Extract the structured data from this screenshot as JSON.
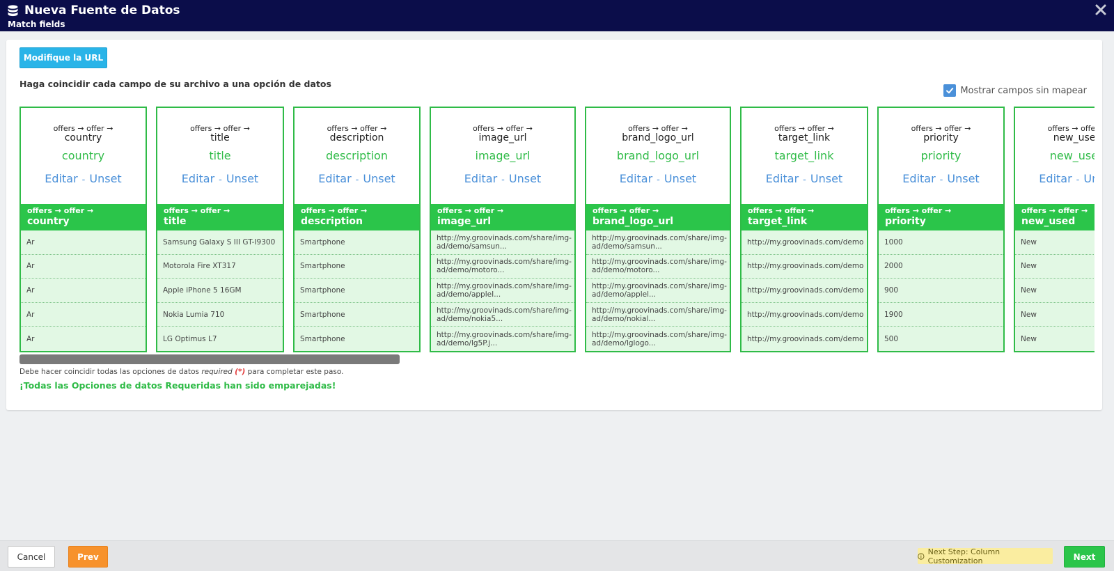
{
  "header": {
    "title": "Nueva Fuente de Datos",
    "subtitle": "Match fields"
  },
  "main": {
    "url_button": "Modifique la URL",
    "instruction": "Haga coincidir cada campo de su archivo a una opción de datos",
    "show_unmapped_label": "Mostrar campos sin mapear",
    "show_unmapped_checked": true,
    "columns": [
      {
        "path": "offers → offer →",
        "field": "country",
        "mapped": "country",
        "edit": "Editar",
        "unset": "Unset",
        "band_path": "offers → offer →",
        "band_name": "country",
        "rows": [
          "Ar",
          "Ar",
          "Ar",
          "Ar",
          "Ar"
        ]
      },
      {
        "path": "offers → offer →",
        "field": "title",
        "mapped": "title",
        "edit": "Editar",
        "unset": "Unset",
        "band_path": "offers → offer →",
        "band_name": "title",
        "rows": [
          "Samsung Galaxy S III GT-I9300",
          "Motorola Fire XT317",
          "Apple iPhone 5 16GM",
          "Nokia Lumia 710",
          "LG Optimus L7"
        ]
      },
      {
        "path": "offers → offer →",
        "field": "description",
        "mapped": "description",
        "edit": "Editar",
        "unset": "Unset",
        "band_path": "offers → offer →",
        "band_name": "description",
        "rows": [
          "Smartphone",
          "Smartphone",
          "Smartphone",
          "Smartphone",
          "Smartphone"
        ]
      },
      {
        "path": "offers → offer →",
        "field": "image_url",
        "mapped": "image_url",
        "edit": "Editar",
        "unset": "Unset",
        "band_path": "offers → offer →",
        "band_name": "image_url",
        "rows": [
          "http://my.groovinads.com/share/img-ad/demo/samsun...",
          "http://my.groovinads.com/share/img-ad/demo/motoro...",
          "http://my.groovinads.com/share/img-ad/demo/appleI...",
          "http://my.groovinads.com/share/img-ad/demo/nokia5...",
          "http://my.groovinads.com/share/img-ad/demo/lg5P.j..."
        ]
      },
      {
        "path": "offers → offer →",
        "field": "brand_logo_url",
        "mapped": "brand_logo_url",
        "edit": "Editar",
        "unset": "Unset",
        "band_path": "offers → offer →",
        "band_name": "brand_logo_url",
        "rows": [
          "http://my.groovinads.com/share/img-ad/demo/samsun...",
          "http://my.groovinads.com/share/img-ad/demo/motoro...",
          "http://my.groovinads.com/share/img-ad/demo/applel...",
          "http://my.groovinads.com/share/img-ad/demo/nokial...",
          "http://my.groovinads.com/share/img-ad/demo/lglogo..."
        ]
      },
      {
        "path": "offers → offer →",
        "field": "target_link",
        "mapped": "target_link",
        "edit": "Editar",
        "unset": "Unset",
        "band_path": "offers → offer →",
        "band_name": "target_link",
        "rows": [
          "http://my.groovinads.com/demo",
          "http://my.groovinads.com/demo",
          "http://my.groovinads.com/demo",
          "http://my.groovinads.com/demo",
          "http://my.groovinads.com/demo"
        ]
      },
      {
        "path": "offers → offer →",
        "field": "priority",
        "mapped": "priority",
        "edit": "Editar",
        "unset": "Unset",
        "band_path": "offers → offer →",
        "band_name": "priority",
        "rows": [
          "1000",
          "2000",
          "900",
          "1900",
          "500"
        ]
      },
      {
        "path": "offers → offer →",
        "field": "new_used",
        "mapped": "new_used",
        "edit": "Editar",
        "unset": "Unset",
        "band_path": "offers → offer →",
        "band_name": "new_used",
        "rows": [
          "New",
          "New",
          "New",
          "New",
          "New"
        ]
      }
    ],
    "note_prefix": "Debe hacer coincidir todas las opciones de datos",
    "note_required": "required",
    "note_star": "(*)",
    "note_suffix": "para completar este paso.",
    "success": "¡Todas las Opciones de datos Requeridas han sido emparejadas!"
  },
  "footer": {
    "cancel": "Cancel",
    "prev": "Prev",
    "next_step": "Next Step: Column Customization",
    "next": "Next"
  },
  "icons": {
    "header": "database-icon",
    "close": "close-icon",
    "checkbox": "checkmark-icon",
    "next_step": "info-icon"
  },
  "colors": {
    "header_bg": "#0b0d4a",
    "accent_green": "#2bc54a",
    "link_blue": "#4a90d9",
    "url_button": "#29b4e8",
    "prev_button": "#f7922c",
    "row_bg": "#e2f8e4",
    "next_step_bg": "#faeda0"
  }
}
